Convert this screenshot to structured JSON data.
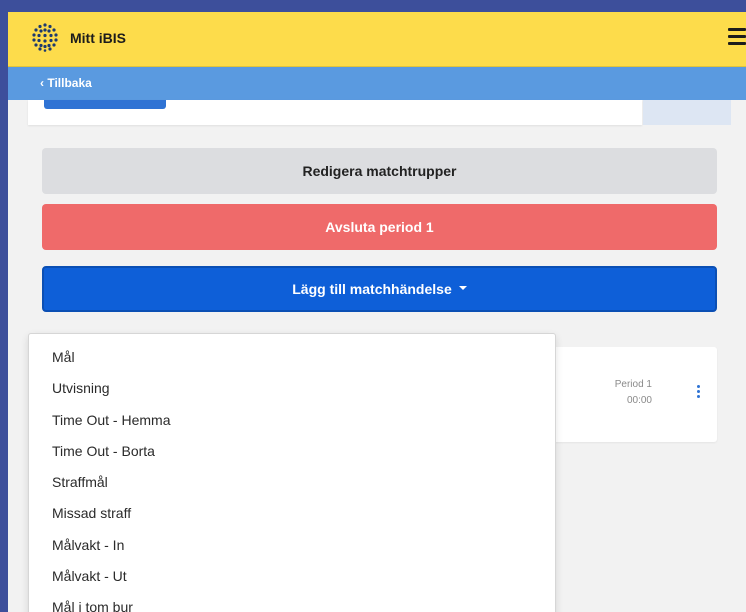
{
  "header": {
    "app_title": "Mitt iBIS",
    "logo_icon": "ibis-logo-icon",
    "menu_icon": "hamburger-icon"
  },
  "subbar": {
    "back_label": "‹ Tillbaka"
  },
  "actions": {
    "edit_squads": "Redigera matchtrupper",
    "end_period": "Avsluta period 1",
    "add_event": "Lägg till matchhändelse"
  },
  "event": {
    "period": "Period 1",
    "time": "00:00"
  },
  "dropdown": {
    "items": [
      "Mål",
      "Utvisning",
      "Time Out - Hemma",
      "Time Out - Borta",
      "Straffmål",
      "Missad straff",
      "Målvakt - In",
      "Målvakt - Ut",
      "Mål i tom bur"
    ]
  },
  "colors": {
    "header_bg": "#fddc4b",
    "subbar_bg": "#5a9ae0",
    "danger": "#ef6a6a",
    "primary": "#0e5fd8",
    "neutral": "#dcdde0"
  }
}
